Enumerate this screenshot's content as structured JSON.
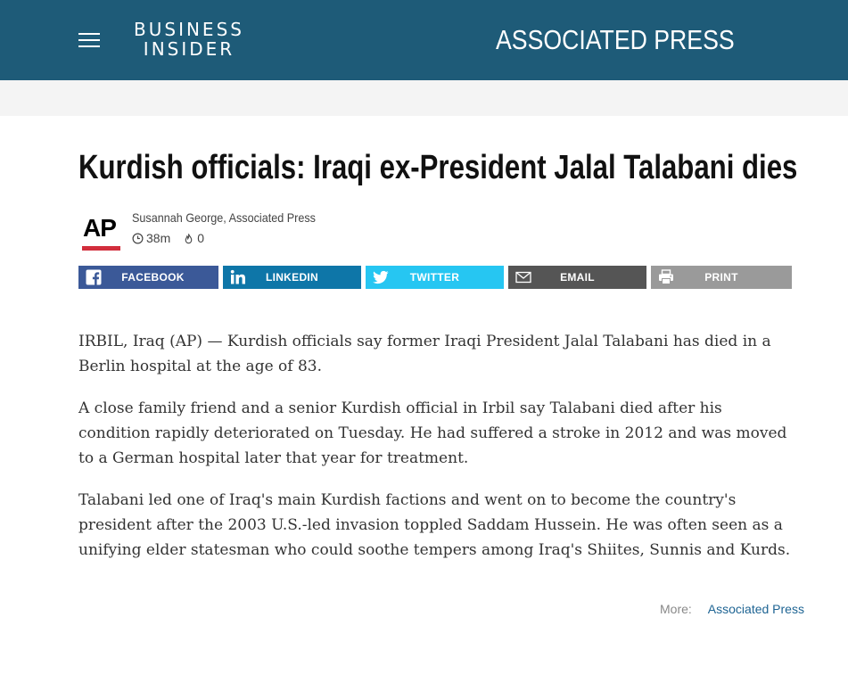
{
  "header": {
    "logo_line1": "BUSINESS",
    "logo_line2": "INSIDER",
    "partner": "ASSOCIATED PRESS",
    "background": "#1e5b78"
  },
  "article": {
    "title": "Kurdish officials: Iraqi ex-President Jalal Talabani dies",
    "author_logo": "AP",
    "byline": "Susannah George, Associated Press",
    "time_ago": "38m",
    "comments": "0",
    "paragraphs": [
      "IRBIL, Iraq (AP) — Kurdish officials say former Iraqi President Jalal Talabani has died in a Berlin hospital at the age of 83.",
      "A close family friend and a senior Kurdish official in Irbil say Talabani died after his condition rapidly deteriorated on Tuesday. He had suffered a stroke in 2012 and was moved to a German hospital later that year for treatment.",
      "Talabani led one of Iraq's main Kurdish factions and went on to become the country's president after the 2003 U.S.-led invasion toppled Saddam Hussein. He was often seen as a unifying elder statesman who could soothe tempers among Iraq's Shiites, Sunnis and Kurds."
    ]
  },
  "share": {
    "facebook": "FACEBOOK",
    "linkedin": "LINKEDIN",
    "twitter": "TWITTER",
    "email": "EMAIL",
    "print": "PRINT"
  },
  "more": {
    "label": "More:",
    "link": "Associated Press"
  },
  "icons": {
    "menu": "hamburger-icon",
    "clock": "clock-icon",
    "comments": "flame-icon",
    "facebook": "facebook-icon",
    "linkedin": "linkedin-icon",
    "twitter": "twitter-icon",
    "email": "envelope-icon",
    "print": "printer-icon"
  },
  "colors": {
    "facebook": "#3b5998",
    "linkedin": "#0e76a8",
    "twitter": "#26c6f2",
    "email": "#555555",
    "print": "#9a9a9a",
    "ap_red": "#d22e3c",
    "link": "#1e6493"
  }
}
